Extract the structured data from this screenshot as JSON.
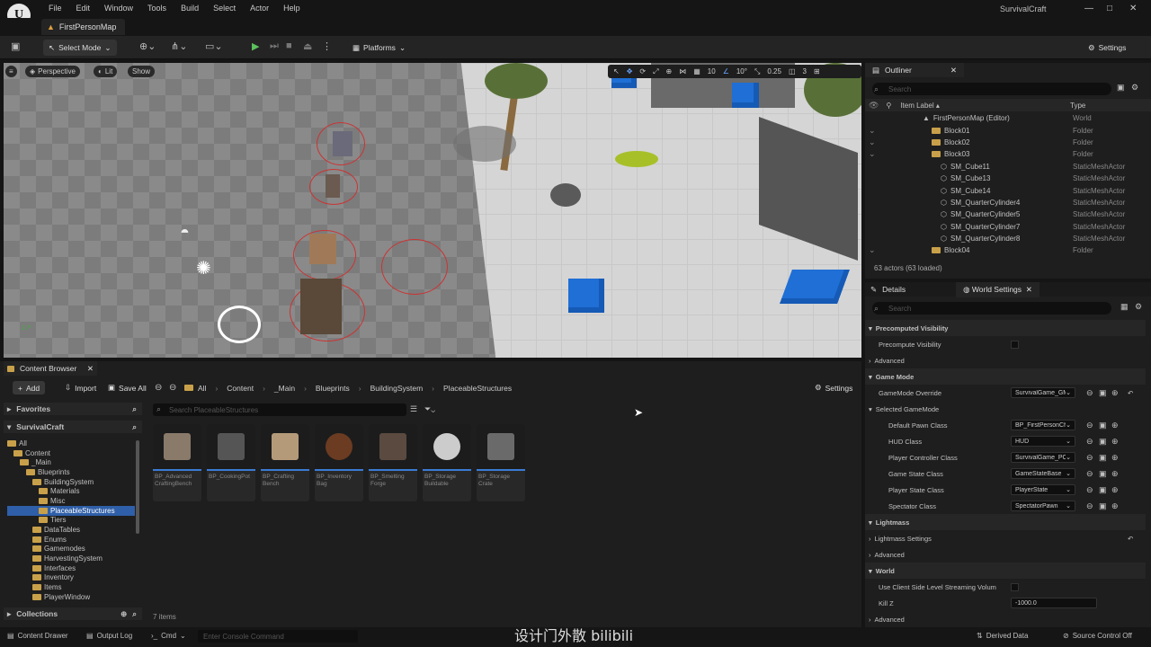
{
  "app": {
    "title": "SurvivalCraft",
    "map_tab": "FirstPersonMap",
    "logo": "U"
  },
  "menu": [
    "File",
    "Edit",
    "Window",
    "Tools",
    "Build",
    "Select",
    "Actor",
    "Help"
  ],
  "toolbar": {
    "select_mode": "Select Mode",
    "platforms": "Platforms",
    "settings": "Settings"
  },
  "viewport": {
    "perspective": "Perspective",
    "lit": "Lit",
    "show": "Show",
    "grid": "10",
    "angle": "10°",
    "scale": "0.25",
    "cam": "3"
  },
  "outliner": {
    "title": "Outliner",
    "search_placeholder": "Search",
    "col_label": "Item Label ▴",
    "col_type": "Type",
    "items": [
      {
        "label": "FirstPersonMap (Editor)",
        "type": "World",
        "indent": 0,
        "icon": "map"
      },
      {
        "label": "Block01",
        "type": "Folder",
        "indent": 1,
        "icon": "folder"
      },
      {
        "label": "Block02",
        "type": "Folder",
        "indent": 1,
        "icon": "folder"
      },
      {
        "label": "Block03",
        "type": "Folder",
        "indent": 1,
        "icon": "folder"
      },
      {
        "label": "SM_Cube11",
        "type": "StaticMeshActor",
        "indent": 2,
        "icon": "mesh"
      },
      {
        "label": "SM_Cube13",
        "type": "StaticMeshActor",
        "indent": 2,
        "icon": "mesh"
      },
      {
        "label": "SM_Cube14",
        "type": "StaticMeshActor",
        "indent": 2,
        "icon": "mesh"
      },
      {
        "label": "SM_QuarterCylinder4",
        "type": "StaticMeshActor",
        "indent": 2,
        "icon": "mesh"
      },
      {
        "label": "SM_QuarterCylinder5",
        "type": "StaticMeshActor",
        "indent": 2,
        "icon": "mesh"
      },
      {
        "label": "SM_QuarterCylinder7",
        "type": "StaticMeshActor",
        "indent": 2,
        "icon": "mesh"
      },
      {
        "label": "SM_QuarterCylinder8",
        "type": "StaticMeshActor",
        "indent": 2,
        "icon": "mesh"
      },
      {
        "label": "Block04",
        "type": "Folder",
        "indent": 1,
        "icon": "folder"
      }
    ],
    "count": "63 actors (63 loaded)"
  },
  "details": {
    "tab_details": "Details",
    "tab_world": "World Settings",
    "search_placeholder": "Search",
    "rows": [
      {
        "label": "Precomputed Visibility",
        "kind": "section"
      },
      {
        "label": "Precompute Visibility",
        "kind": "check"
      },
      {
        "label": "Advanced",
        "kind": "adv"
      },
      {
        "label": "Game Mode",
        "kind": "section"
      },
      {
        "label": "GameMode Override",
        "kind": "select",
        "value": "SurvivalGame_GM"
      },
      {
        "label": "Selected GameMode",
        "kind": "sub"
      },
      {
        "label": "Default Pawn Class",
        "kind": "select2",
        "value": "BP_FirstPersonCh"
      },
      {
        "label": "HUD Class",
        "kind": "select2",
        "value": "HUD"
      },
      {
        "label": "Player Controller Class",
        "kind": "select2",
        "value": "SurvivalGame_PC"
      },
      {
        "label": "Game State Class",
        "kind": "select2",
        "value": "GameStateBase"
      },
      {
        "label": "Player State Class",
        "kind": "select2",
        "value": "PlayerState"
      },
      {
        "label": "Spectator Class",
        "kind": "select2",
        "value": "SpectatorPawn"
      },
      {
        "label": "Lightmass",
        "kind": "section"
      },
      {
        "label": "Lightmass Settings",
        "kind": "adv"
      },
      {
        "label": "Advanced",
        "kind": "adv"
      },
      {
        "label": "World",
        "kind": "section"
      },
      {
        "label": "Use Client Side Level Streaming Volum",
        "kind": "check"
      },
      {
        "label": "Kill Z",
        "kind": "num",
        "value": "-1000.0"
      },
      {
        "label": "Advanced",
        "kind": "adv"
      }
    ]
  },
  "content_browser": {
    "title": "Content Browser",
    "add": "Add",
    "import": "Import",
    "save_all": "Save All",
    "settings": "Settings",
    "breadcrumb": [
      "All",
      "Content",
      "_Main",
      "Blueprints",
      "BuildingSystem",
      "PlaceableStructures"
    ],
    "favorites": "Favorites",
    "project": "SurvivalCraft",
    "search_placeholder": "Search PlaceableStructures",
    "tree": [
      {
        "label": "All",
        "indent": 0
      },
      {
        "label": "Content",
        "indent": 1
      },
      {
        "label": "_Main",
        "indent": 2
      },
      {
        "label": "Blueprints",
        "indent": 3
      },
      {
        "label": "BuildingSystem",
        "indent": 4
      },
      {
        "label": "Materials",
        "indent": 5
      },
      {
        "label": "Misc",
        "indent": 5
      },
      {
        "label": "PlaceableStructures",
        "indent": 5,
        "selected": true
      },
      {
        "label": "Tiers",
        "indent": 5
      },
      {
        "label": "DataTables",
        "indent": 4
      },
      {
        "label": "Enums",
        "indent": 4
      },
      {
        "label": "Gamemodes",
        "indent": 4
      },
      {
        "label": "HarvestingSystem",
        "indent": 4
      },
      {
        "label": "Interfaces",
        "indent": 4
      },
      {
        "label": "Inventory",
        "indent": 4
      },
      {
        "label": "Items",
        "indent": 4
      },
      {
        "label": "PlayerWindow",
        "indent": 4
      }
    ],
    "collections": "Collections",
    "assets": [
      {
        "name": "BP_Advanced CraftingBench",
        "color": "#8a7a6a"
      },
      {
        "name": "BP_CookingPot",
        "color": "#555"
      },
      {
        "name": "BP_Crafting Bench",
        "color": "#b59a7a"
      },
      {
        "name": "BP_Inventory Bag",
        "color": "#6b3c22"
      },
      {
        "name": "BP_Smelting Forge",
        "color": "#5a4a40"
      },
      {
        "name": "BP_Storage Buildable",
        "color": "#ccc"
      },
      {
        "name": "BP_Storage Crate",
        "color": "#6a6a6a"
      }
    ],
    "items_count": "7 items"
  },
  "statusbar": {
    "content_drawer": "Content Drawer",
    "output_log": "Output Log",
    "cmd": "Cmd",
    "console_placeholder": "Enter Console Command",
    "derived": "Derived Data",
    "source": "Source Control Off"
  },
  "watermark": "设计门外散 bilibili"
}
